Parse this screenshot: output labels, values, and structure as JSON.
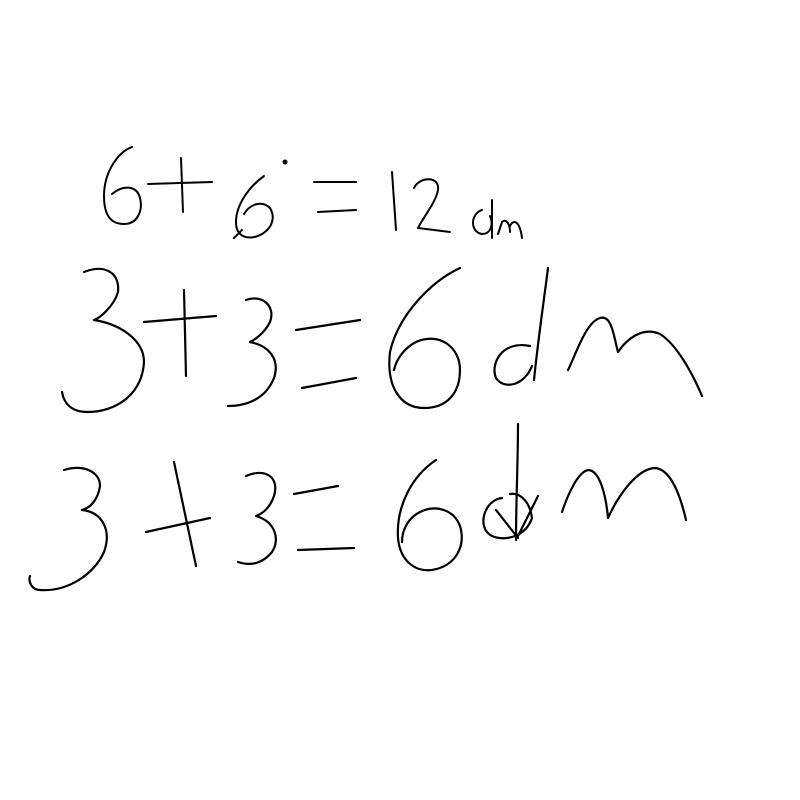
{
  "lines": [
    {
      "text": "6+6=12dm"
    },
    {
      "text": "3+3=6dm"
    },
    {
      "text": "3+3=6dm"
    }
  ],
  "ink_color": "#000000",
  "background_color": "#ffffff"
}
